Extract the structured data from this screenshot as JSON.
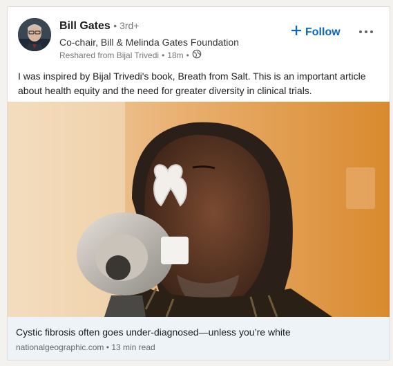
{
  "post": {
    "author_name": "Bill Gates",
    "degree": "3rd+",
    "headline": "Co-chair, Bill & Melinda Gates Foundation",
    "reshared_from": "Reshared from Bijal Trivedi",
    "time_ago": "18m",
    "visibility_icon": "globe-icon",
    "follow_label": "Follow",
    "more_icon": "more-options-icon",
    "text": "I was inspired by Bijal Trivedi's book, Breath from Salt. This is an important article about health equity and the need for greater diversity in clinical trials."
  },
  "article": {
    "title": "Cystic fibrosis often goes under-diagnosed—unless you’re white",
    "source": "nationalgeographic.com",
    "read_time": "13 min read"
  },
  "colors": {
    "accent": "#0a66c2",
    "link_bg": "#eef3f8",
    "hero_wall": "#d98a2e"
  }
}
